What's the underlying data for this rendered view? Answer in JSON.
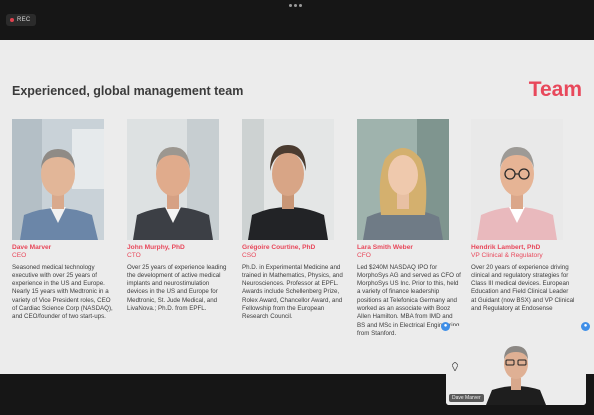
{
  "recording": {
    "label": "REC"
  },
  "slide": {
    "title": "Experienced, global management team",
    "heading": "Team",
    "members": [
      {
        "name": "Dave Marver",
        "role": "CEO",
        "bio": "Seasoned medical technology executive with over 25 years of experience in the US and Europe. Nearly 15 years with Medtronic in a variety of Vice President roles, CEO of Cardiac Science Corp (NASDAQ), and CEO/founder of two start-ups."
      },
      {
        "name": "John Murphy, PhD",
        "role": "CTO",
        "bio": "Over 25 years of experience leading the development of active medical implants and neurostimulation devices in the US and Europe for Medtronic, St. Jude Medical, and LivaNova.; Ph.D. from EPFL."
      },
      {
        "name": "Grégoire Courtine, PhD",
        "role": "CSO",
        "bio": "Ph.D. in Experimental Medicine and trained in Mathematics, Physics, and Neurosciences. Professor at EPFL. Awards include Schellenberg Prize, Rolex Award, Chancellor Award, and Fellowship from the European Research Council."
      },
      {
        "name": "Lara Smith Weber",
        "role": "CFO",
        "bio": "Led $240M NASDAQ IPO for MorphoSys AG and served as CFO of MorphoSys US Inc. Prior to this, held a variety of finance leadership positions at Telefonica Germany and worked as an associate with Booz Allen Hamilton. MBA from IMD and BS and MSc in Electrical Engineering from Stanford."
      },
      {
        "name": "Hendrik Lambert, PhD",
        "role": "VP Clinical & Regulatory",
        "bio": "Over 20 years of experience driving clinical and regulatory strategies for Class III medical devices. European Education and Field Clinical Leader at Guidant (now BSX) and VP Clinical and Regulatory at Endosense"
      }
    ]
  },
  "self_view": {
    "name": "Dave Marver"
  },
  "colors": {
    "accent": "#e8485b",
    "slide_bg": "#ececec",
    "chrome": "#161616",
    "badge": "#3f8fe8"
  },
  "icons": {
    "rec": "record-dot-icon",
    "menu": "more-dots-icon",
    "left_badge": "participant-icon",
    "right_badge": "pin-icon",
    "logo": "company-logo-icon"
  }
}
